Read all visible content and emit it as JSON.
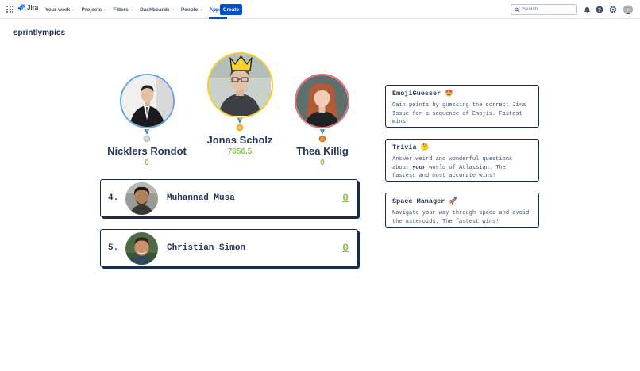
{
  "nav": {
    "logo_text": "Jira",
    "items": [
      {
        "label": "Your work"
      },
      {
        "label": "Projects"
      },
      {
        "label": "Filters"
      },
      {
        "label": "Dashboards"
      },
      {
        "label": "People"
      },
      {
        "label": "Apps"
      }
    ],
    "active_item": "Apps",
    "create_label": "Create",
    "search_placeholder": "Search"
  },
  "page": {
    "title": "sprintlympics"
  },
  "podium": {
    "first": {
      "name": "Jonas Scholz",
      "score": "7656.5",
      "medal": "gold"
    },
    "second": {
      "name": "Nicklers Rondot",
      "score": "0",
      "medal": "silver"
    },
    "third": {
      "name": "Thea Killig",
      "score": "0",
      "medal": "bronze"
    }
  },
  "ranking": [
    {
      "rank": "4.",
      "name": "Muhannad Musa",
      "score": "0"
    },
    {
      "rank": "5.",
      "name": "Christian Simon",
      "score": "0"
    }
  ],
  "games": [
    {
      "title": "EmojiGuesser 🤩",
      "desc": "Gain points by guessing the correct Jira Issue for a sequence of Emojis. Fastest wins!"
    },
    {
      "title": "Trivia 🤔",
      "desc_pre": "Answer weird and wonderful questions about ",
      "desc_bold": "your",
      "desc_post": " world of Atlassian. The fastest and most accurate wins!"
    },
    {
      "title": "Space Manager 🚀",
      "desc": "Navigate your way through space and avoid the asteroids. The fastest wins!"
    }
  ],
  "colors": {
    "brand_blue": "#0052cc",
    "score_green": "#8bc34a",
    "gold_ring": "#f5cd2b",
    "silver_ring": "#6aa5de",
    "bronze_ring": "#e2727a"
  }
}
